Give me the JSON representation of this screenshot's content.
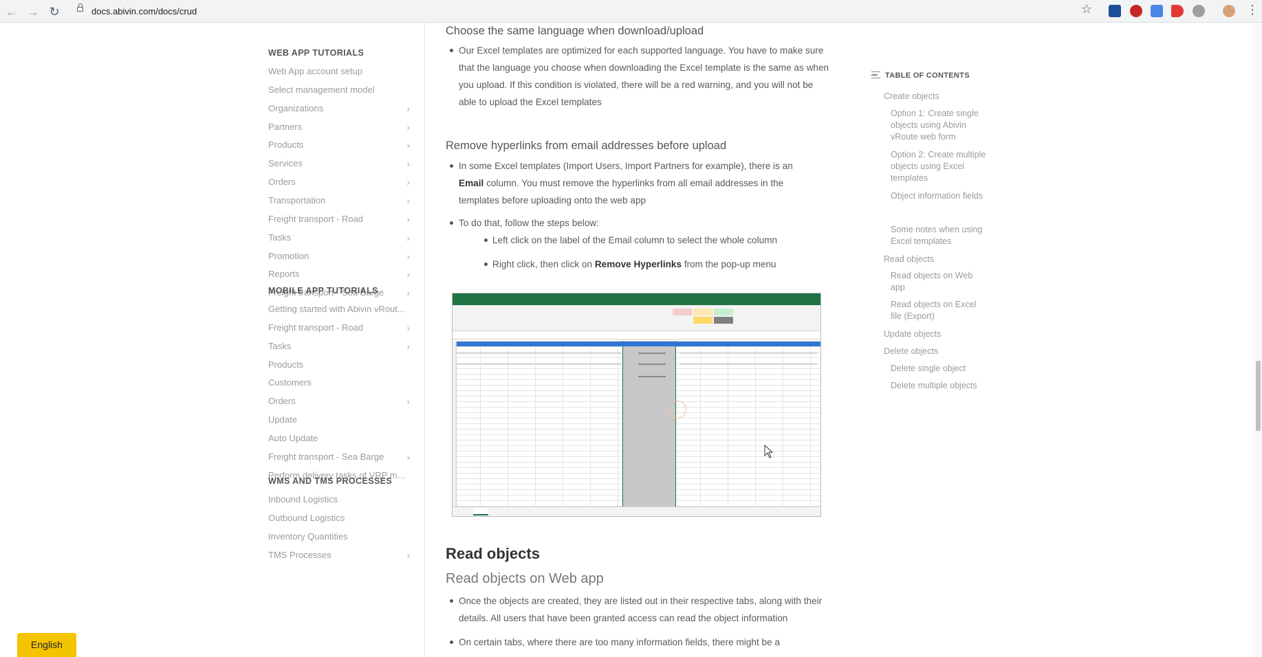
{
  "browser": {
    "url": "docs.abivin.com/docs/crud",
    "back_icon": "←",
    "forward_icon": "→",
    "reload_icon": "↻",
    "star_icon": "☆",
    "menu_icon": "⋮"
  },
  "sidebar": {
    "sections": [
      {
        "title": "WEB APP TUTORIALS",
        "items": [
          {
            "label": "Web App account setup",
            "chevron": false
          },
          {
            "label": "Select management model",
            "chevron": false
          },
          {
            "label": "Organizations",
            "chevron": true
          },
          {
            "label": "Partners",
            "chevron": true
          },
          {
            "label": "Products",
            "chevron": true
          },
          {
            "label": "Services",
            "chevron": true
          },
          {
            "label": "Orders",
            "chevron": true
          },
          {
            "label": "Transportation",
            "chevron": true
          },
          {
            "label": "Freight transport - Road",
            "chevron": true
          },
          {
            "label": "Tasks",
            "chevron": true
          },
          {
            "label": "Promotion",
            "chevron": true
          },
          {
            "label": "Reports",
            "chevron": true
          },
          {
            "label": "Freight transport - Sea Barge",
            "chevron": true
          }
        ]
      },
      {
        "title": "MOBILE APP TUTORIALS",
        "items": [
          {
            "label": "Getting started with Abivin vRout...",
            "chevron": false
          },
          {
            "label": "Freight transport - Road",
            "chevron": true
          },
          {
            "label": "Tasks",
            "chevron": true
          },
          {
            "label": "Products",
            "chevron": false
          },
          {
            "label": "Customers",
            "chevron": false
          },
          {
            "label": "Orders",
            "chevron": true
          },
          {
            "label": "Update",
            "chevron": false
          },
          {
            "label": "Auto Update",
            "chevron": false
          },
          {
            "label": "Freight transport - Sea Barge",
            "chevron": true
          },
          {
            "label": "Perform delivery tasks of VRP mo...",
            "chevron": false
          }
        ]
      },
      {
        "title": "WMS AND TMS PROCESSES",
        "items": [
          {
            "label": "Inbound Logistics",
            "chevron": false
          },
          {
            "label": "Outbound Logistics",
            "chevron": false
          },
          {
            "label": "Inventory Quantities",
            "chevron": false
          },
          {
            "label": "TMS Processes",
            "chevron": true
          }
        ]
      }
    ],
    "chevron_glyph": "›",
    "language_button": "English"
  },
  "content": {
    "h_same_language": "Choose the same language when download/upload",
    "p_same_language": "Our Excel templates are optimized for each supported language. You have to make sure that the language you choose when downloading the Excel template is the same as when you upload. If this condition is violated, there will be a red warning, and you will not be able to upload the Excel templates",
    "h_hyperlinks": "Remove hyperlinks from email addresses before upload",
    "p_hyperlinks_pre": "In some Excel templates (Import Users, Import Partners for example), there is an",
    "p_hyperlinks_bold": "Email",
    "p_hyperlinks_post": "column. You must remove the hyperlinks from all email addresses in the templates before uploading onto the web app",
    "p_steps_intro": "To do that, follow the steps below:",
    "step1": "Left click on the label of the Email column to select the whole column",
    "step2_pre": "Right click, then click on",
    "step2_bold": "Remove Hyperlinks",
    "step2_post": "from the pop-up menu",
    "h_read_objects": "Read objects",
    "h_read_web": "Read objects on Web app",
    "p_read_web": "Once the objects are created, they are listed out in their respective tabs, along with their details. All users that have been granted access can read the object information",
    "p_read_tabs": "On certain tabs, where there are too many information fields, there might be a"
  },
  "toc": {
    "heading": "TABLE OF CONTENTS",
    "items": [
      {
        "label": "Create objects",
        "level": 1
      },
      {
        "label": "Option 1: Create single objects using Abivin vRoute web form",
        "level": 2
      },
      {
        "label": "Option 2: Create multiple objects using Excel templates",
        "level": 2
      },
      {
        "label": "Object information fields",
        "level": 2
      },
      {
        "label": "Some notes when using Excel templates",
        "level": 2
      },
      {
        "label": "Read objects",
        "level": 1
      },
      {
        "label": "Read objects on Web app",
        "level": 2
      },
      {
        "label": "Read objects on Excel file (Export)",
        "level": 2
      },
      {
        "label": "Update objects",
        "level": 1
      },
      {
        "label": "Delete objects",
        "level": 1
      },
      {
        "label": "Delete single object",
        "level": 2
      },
      {
        "label": "Delete multiple objects",
        "level": 2
      }
    ]
  },
  "colors": {
    "accent_yellow": "#f5c400",
    "excel_green": "#217346",
    "excel_header_blue": "#2e75d6"
  }
}
